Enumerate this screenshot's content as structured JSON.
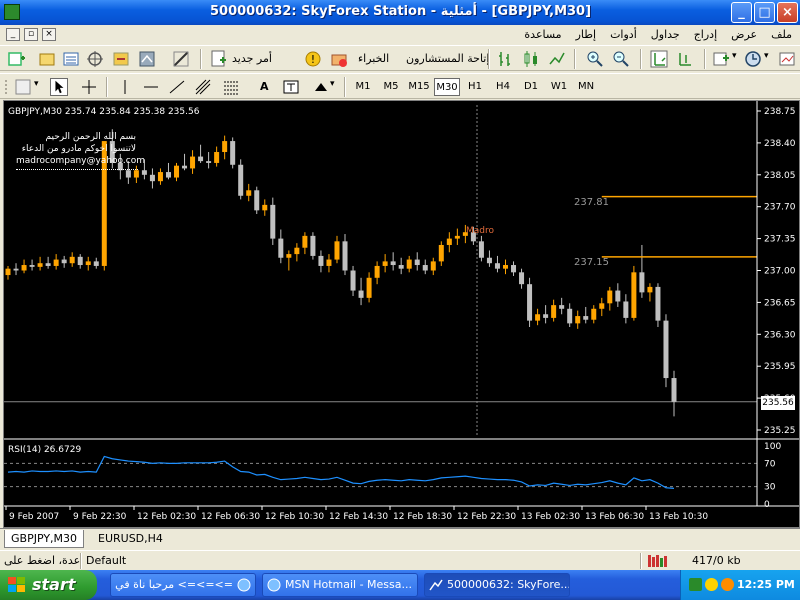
{
  "window": {
    "title": "500000632: SkyForex Station - أمثلية - [GBPJPY,M30]",
    "buttons": {
      "minimize": "_",
      "maximize": "□",
      "close": "×"
    }
  },
  "menu": {
    "items": [
      "ملف",
      "عرض",
      "إدراج",
      "جداول",
      "أدوات",
      "إطار",
      "مساعدة"
    ]
  },
  "toolbar1": {
    "new_order_label": "أمر جديد",
    "experts_label": "الخبراء",
    "advisors_label": "إتاحة المستشارون"
  },
  "toolbar2": {
    "timeframes": [
      "M1",
      "M5",
      "M15",
      "M30",
      "H1",
      "H4",
      "D1",
      "W1",
      "MN"
    ],
    "active_timeframe": "M30",
    "text_tool": "A"
  },
  "chart": {
    "header": "GBPJPY,M30  235.74 235.84 235.38 235.56",
    "comment_lines": [
      "بسم الله الرحمن الرحيم",
      "لاتنسوا اخوكم مادرو من الدعاء",
      "madrocompany@yahoo.com"
    ],
    "madro_label": "Madro",
    "current_price_label": "235.56",
    "lines": [
      {
        "label": "237.81",
        "price": 237.81,
        "color": "#ffa500"
      },
      {
        "label": "237.15",
        "price": 237.15,
        "color": "#ffa500"
      }
    ],
    "price_axis": [
      "238.75",
      "238.40",
      "238.05",
      "237.70",
      "237.35",
      "237.00",
      "236.65",
      "236.30",
      "235.95",
      "235.60",
      "235.25"
    ],
    "time_axis": [
      "9 Feb 2007",
      "9 Feb 22:30",
      "12 Feb 02:30",
      "12 Feb 06:30",
      "12 Feb 10:30",
      "12 Feb 14:30",
      "12 Feb 18:30",
      "12 Feb 22:30",
      "13 Feb 02:30",
      "13 Feb 06:30",
      "13 Feb 10:30"
    ],
    "colors": {
      "bull": "#ffa500",
      "bear": "#c0c0c0",
      "background": "#000000",
      "axis_text": "#ffffff"
    }
  },
  "rsi": {
    "header": "RSI(14) 26.6729",
    "levels": [
      "100",
      "70",
      "30",
      "0"
    ],
    "color": "#1e90ff"
  },
  "chart_data": {
    "type": "candlestick",
    "symbol": "GBPJPY",
    "timeframe": "M30",
    "ylim": [
      235.25,
      238.75
    ],
    "candles": [
      [
        236.95,
        237.05,
        236.9,
        237.02
      ],
      [
        237.02,
        237.08,
        236.95,
        237.0
      ],
      [
        237.0,
        237.12,
        236.97,
        237.06
      ],
      [
        237.06,
        237.12,
        237.0,
        237.04
      ],
      [
        237.04,
        237.15,
        237.0,
        237.08
      ],
      [
        237.08,
        237.15,
        237.02,
        237.05
      ],
      [
        237.05,
        237.18,
        237.01,
        237.12
      ],
      [
        237.12,
        237.16,
        237.03,
        237.08
      ],
      [
        237.08,
        237.2,
        237.04,
        237.15
      ],
      [
        237.15,
        237.18,
        237.02,
        237.06
      ],
      [
        237.06,
        237.15,
        237.0,
        237.1
      ],
      [
        237.1,
        237.14,
        237.02,
        237.05
      ],
      [
        237.05,
        237.45,
        237.0,
        238.42
      ],
      [
        238.42,
        238.55,
        238.12,
        238.18
      ],
      [
        238.18,
        238.28,
        238.0,
        238.1
      ],
      [
        238.1,
        238.2,
        237.95,
        238.02
      ],
      [
        238.02,
        238.15,
        237.96,
        238.1
      ],
      [
        238.1,
        238.22,
        238.0,
        238.05
      ],
      [
        238.05,
        238.12,
        237.9,
        237.98
      ],
      [
        237.98,
        238.12,
        237.94,
        238.08
      ],
      [
        238.08,
        238.18,
        238.0,
        238.02
      ],
      [
        238.02,
        238.18,
        237.98,
        238.15
      ],
      [
        238.15,
        238.28,
        238.1,
        238.12
      ],
      [
        238.12,
        238.32,
        238.06,
        238.25
      ],
      [
        238.25,
        238.38,
        238.18,
        238.2
      ],
      [
        238.2,
        238.3,
        238.12,
        238.18
      ],
      [
        238.18,
        238.36,
        238.14,
        238.3
      ],
      [
        238.3,
        238.48,
        238.22,
        238.42
      ],
      [
        238.42,
        238.46,
        238.12,
        238.16
      ],
      [
        238.16,
        238.22,
        237.78,
        237.82
      ],
      [
        237.82,
        237.95,
        237.76,
        237.88
      ],
      [
        237.88,
        237.92,
        237.62,
        237.66
      ],
      [
        237.66,
        237.78,
        237.6,
        237.72
      ],
      [
        237.72,
        237.8,
        237.28,
        237.35
      ],
      [
        237.35,
        237.45,
        237.08,
        237.14
      ],
      [
        237.14,
        237.22,
        237.0,
        237.18
      ],
      [
        237.18,
        237.3,
        237.1,
        237.25
      ],
      [
        237.25,
        237.42,
        237.18,
        237.38
      ],
      [
        237.38,
        237.42,
        237.12,
        237.16
      ],
      [
        237.16,
        237.22,
        236.98,
        237.05
      ],
      [
        237.05,
        237.18,
        236.98,
        237.12
      ],
      [
        237.12,
        237.38,
        237.08,
        237.32
      ],
      [
        237.32,
        237.4,
        236.95,
        237.0
      ],
      [
        237.0,
        237.05,
        236.72,
        236.78
      ],
      [
        236.78,
        236.92,
        236.62,
        236.7
      ],
      [
        236.7,
        236.98,
        236.65,
        236.92
      ],
      [
        236.92,
        237.1,
        236.85,
        237.05
      ],
      [
        237.05,
        237.18,
        236.98,
        237.1
      ],
      [
        237.1,
        237.2,
        237.0,
        237.06
      ],
      [
        237.06,
        237.14,
        236.96,
        237.02
      ],
      [
        237.02,
        237.16,
        236.98,
        237.12
      ],
      [
        237.12,
        237.2,
        237.0,
        237.06
      ],
      [
        237.06,
        237.12,
        236.96,
        237.0
      ],
      [
        237.0,
        237.14,
        236.95,
        237.1
      ],
      [
        237.1,
        237.32,
        237.05,
        237.28
      ],
      [
        237.28,
        237.42,
        237.2,
        237.35
      ],
      [
        237.35,
        237.46,
        237.28,
        237.38
      ],
      [
        237.38,
        237.5,
        237.3,
        237.42
      ],
      [
        237.42,
        237.48,
        237.28,
        237.32
      ],
      [
        237.32,
        237.38,
        237.1,
        237.14
      ],
      [
        237.14,
        237.22,
        237.04,
        237.08
      ],
      [
        237.08,
        237.16,
        236.98,
        237.02
      ],
      [
        237.02,
        237.12,
        236.96,
        237.06
      ],
      [
        237.06,
        237.1,
        236.94,
        236.98
      ],
      [
        236.98,
        237.02,
        236.8,
        236.85
      ],
      [
        236.85,
        236.92,
        236.38,
        236.45
      ],
      [
        236.45,
        236.58,
        236.4,
        236.52
      ],
      [
        236.52,
        236.62,
        236.42,
        236.48
      ],
      [
        236.48,
        236.68,
        236.44,
        236.62
      ],
      [
        236.62,
        236.7,
        236.52,
        236.58
      ],
      [
        236.58,
        236.64,
        236.38,
        236.42
      ],
      [
        236.42,
        236.56,
        236.36,
        236.5
      ],
      [
        236.5,
        236.6,
        236.42,
        236.46
      ],
      [
        236.46,
        236.62,
        236.42,
        236.58
      ],
      [
        236.58,
        236.7,
        236.5,
        236.64
      ],
      [
        236.64,
        236.82,
        236.56,
        236.78
      ],
      [
        236.78,
        236.86,
        236.6,
        236.66
      ],
      [
        236.66,
        236.74,
        236.42,
        236.48
      ],
      [
        236.48,
        237.05,
        236.45,
        236.98
      ],
      [
        236.98,
        237.28,
        236.7,
        236.76
      ],
      [
        236.76,
        236.86,
        236.66,
        236.82
      ],
      [
        236.82,
        236.86,
        236.38,
        236.45
      ],
      [
        236.45,
        236.52,
        235.72,
        235.82
      ],
      [
        235.82,
        235.9,
        235.4,
        235.56
      ]
    ],
    "rsi_values": [
      55,
      56,
      55,
      57,
      56,
      56,
      57,
      56,
      57,
      55,
      56,
      55,
      82,
      78,
      76,
      74,
      73,
      72,
      70,
      71,
      70,
      70,
      71,
      71,
      71,
      71,
      72,
      74,
      64,
      56,
      55,
      50,
      51,
      46,
      42,
      43,
      44,
      46,
      44,
      42,
      43,
      46,
      41,
      36,
      35,
      39,
      41,
      42,
      41,
      40,
      42,
      41,
      40,
      42,
      45,
      46,
      47,
      48,
      46,
      44,
      43,
      42,
      42,
      41,
      38,
      31,
      33,
      32,
      36,
      34,
      32,
      34,
      33,
      35,
      37,
      40,
      36,
      33,
      45,
      40,
      42,
      36,
      28,
      27
    ]
  },
  "tabs": [
    "GBPJPY,M30",
    "EURUSD,H4"
  ],
  "status": {
    "help": "عدة، اضغط على",
    "profile": "Default",
    "traffic": "417/0 kb"
  },
  "taskbar": {
    "start_label": "start",
    "buttons": [
      "=>=>=> مرحبا ناة في ال...",
      "MSN Hotmail - Messa...",
      "500000632: SkyFore..."
    ],
    "clock": "12:25 PM"
  }
}
